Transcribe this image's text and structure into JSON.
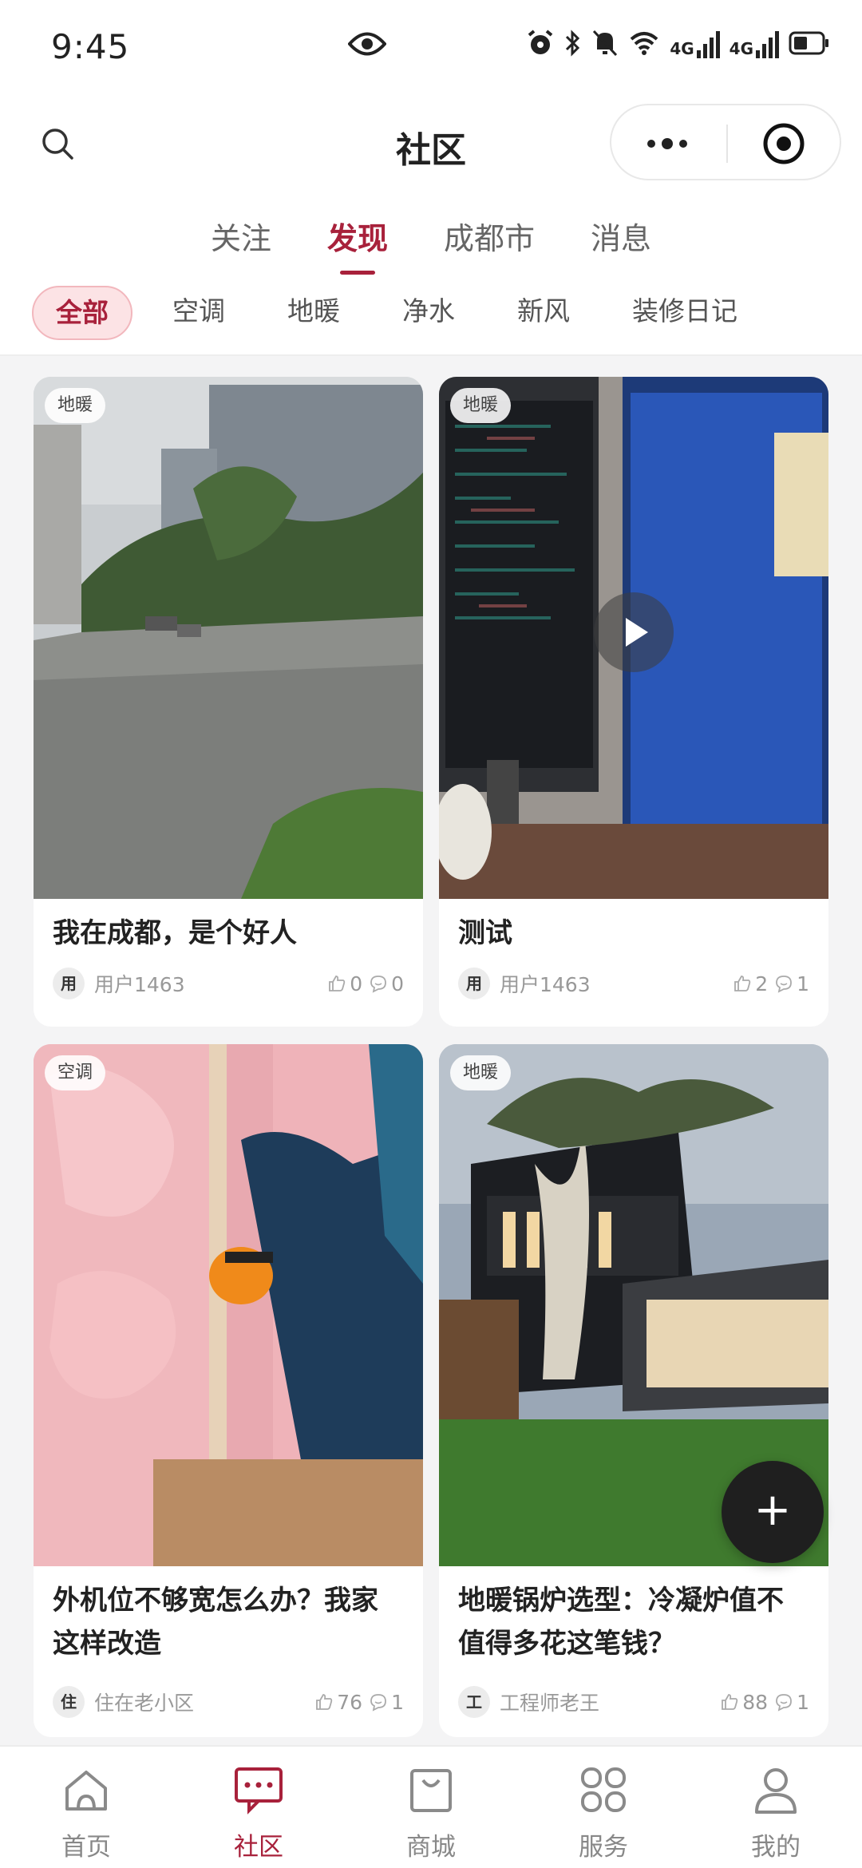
{
  "status_bar": {
    "time": "9:45",
    "network_1": "4G",
    "network_2": "4G"
  },
  "header": {
    "title": "社区"
  },
  "tabs": [
    {
      "label": "关注",
      "active": false
    },
    {
      "label": "发现",
      "active": true
    },
    {
      "label": "成都市",
      "active": false
    },
    {
      "label": "消息",
      "active": false
    }
  ],
  "categories": [
    {
      "label": "全部",
      "active": true
    },
    {
      "label": "空调",
      "active": false
    },
    {
      "label": "地暖",
      "active": false
    },
    {
      "label": "净水",
      "active": false
    },
    {
      "label": "新风",
      "active": false
    },
    {
      "label": "装修日记",
      "active": false
    }
  ],
  "posts": [
    {
      "tag": "地暖",
      "title": "我在成都，是个好人",
      "avatar_char": "用",
      "user": "用户1463",
      "likes": "0",
      "comments": "0",
      "is_video": false
    },
    {
      "tag": "地暖",
      "title": "测试",
      "avatar_char": "用",
      "user": "用户1463",
      "likes": "2",
      "comments": "1",
      "is_video": true
    },
    {
      "tag": "空调",
      "title": "外机位不够宽怎么办？我家这样改造",
      "avatar_char": "住",
      "user": "住在老小区",
      "likes": "76",
      "comments": "1",
      "is_video": false
    },
    {
      "tag": "地暖",
      "title": "地暖锅炉选型：冷凝炉值不值得多花这笔钱？",
      "avatar_char": "工",
      "user": "工程师老王",
      "likes": "88",
      "comments": "1",
      "is_video": false
    }
  ],
  "fab": {
    "symbol": "+"
  },
  "bottom_nav": [
    {
      "label": "首页",
      "icon": "home-icon",
      "active": false
    },
    {
      "label": "社区",
      "icon": "community-chat-icon",
      "active": true
    },
    {
      "label": "商城",
      "icon": "shopping-bag-icon",
      "active": false
    },
    {
      "label": "服务",
      "icon": "grid-icon",
      "active": false
    },
    {
      "label": "我的",
      "icon": "user-icon",
      "active": false
    }
  ],
  "colors": {
    "accent": "#a8213b",
    "chip_bg": "#fce3e5",
    "fab": "#1f1f1f"
  }
}
